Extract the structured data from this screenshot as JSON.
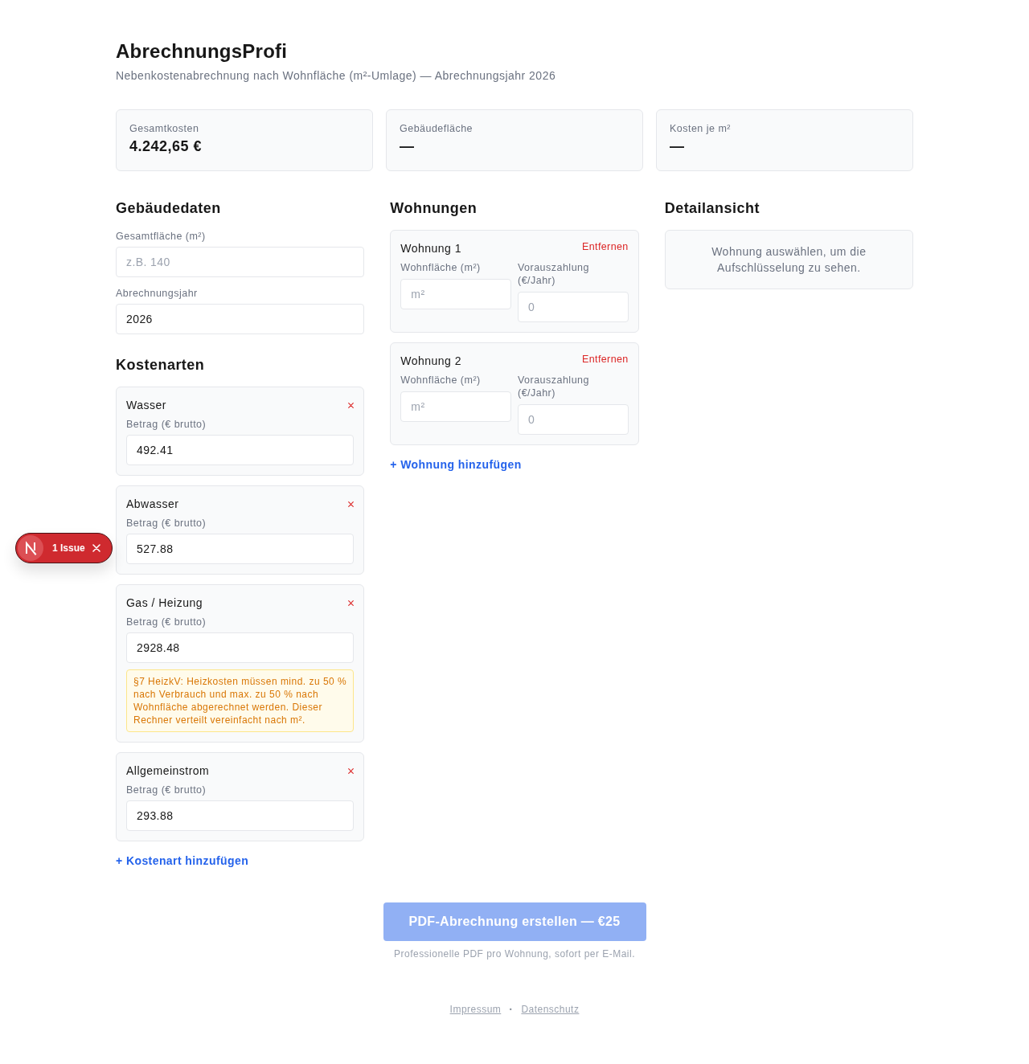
{
  "header": {
    "title": "AbrechnungsProfi",
    "subtitle": "Nebenkostenabrechnung nach Wohnfläche (m²-Umlage) — Abrechnungsjahr 2026"
  },
  "stats": [
    {
      "label": "Gesamtkosten",
      "value": "4.242,65 €"
    },
    {
      "label": "Gebäudefläche",
      "value": "—"
    },
    {
      "label": "Kosten je m²",
      "value": "—"
    }
  ],
  "building": {
    "heading": "Gebäudedaten",
    "fields": [
      {
        "label": "Gesamtfläche (m²)",
        "placeholder": "z.B. 140"
      },
      {
        "label": "Abrechnungsjahr",
        "value": "2026"
      }
    ]
  },
  "costs": {
    "heading": "Kostenarten",
    "items": [
      {
        "name": "Wasser",
        "amount_label": "Betrag (€ brutto)",
        "value": "492.41"
      },
      {
        "name": "Abwasser",
        "amount_label": "Betrag (€ brutto)",
        "value": "527.88"
      },
      {
        "name": "Gas / Heizung",
        "amount_label": "Betrag (€ brutto)",
        "value": "2928.48",
        "notice": "§7 HeizkV: Heizkosten müssen mind. zu 50 % nach Verbrauch und max. zu 50 % nach Wohnfläche abgerechnet werden. Dieser Rechner verteilt vereinfacht nach m²."
      },
      {
        "name": "Allgemeinstrom",
        "amount_label": "Betrag (€ brutto)",
        "value": "293.88"
      }
    ],
    "add_link": "+ Kostenart hinzufügen"
  },
  "apartments": {
    "heading": "Wohnungen",
    "items": [
      {
        "name": "Wohnung 1",
        "remove_label": "Entfernen",
        "area_label": "Wohnfläche (m²)",
        "area_placeholder": "m²",
        "payment_label": "Vorauszahlung (€/Jahr)",
        "payment_placeholder": "0"
      },
      {
        "name": "Wohnung 2",
        "remove_label": "Entfernen",
        "area_label": "Wohnfläche (m²)",
        "area_placeholder": "m²",
        "payment_label": "Vorauszahlung (€/Jahr)",
        "payment_placeholder": "0"
      }
    ],
    "add_link": "+ Wohnung hinzufügen"
  },
  "detail": {
    "heading": "Detailansicht",
    "empty_text": "Wohnung auswählen, um die Aufschlüsselung zu sehen."
  },
  "cta": {
    "label": "PDF-Abrechnung erstellen — €25",
    "disabled": true,
    "note": "Professionelle PDF pro Wohnung, sofort per E-Mail."
  },
  "footer": {
    "links": [
      "Impressum",
      "Datenschutz"
    ],
    "separator": "·"
  },
  "issue_badge": {
    "label": "1 Issue"
  }
}
